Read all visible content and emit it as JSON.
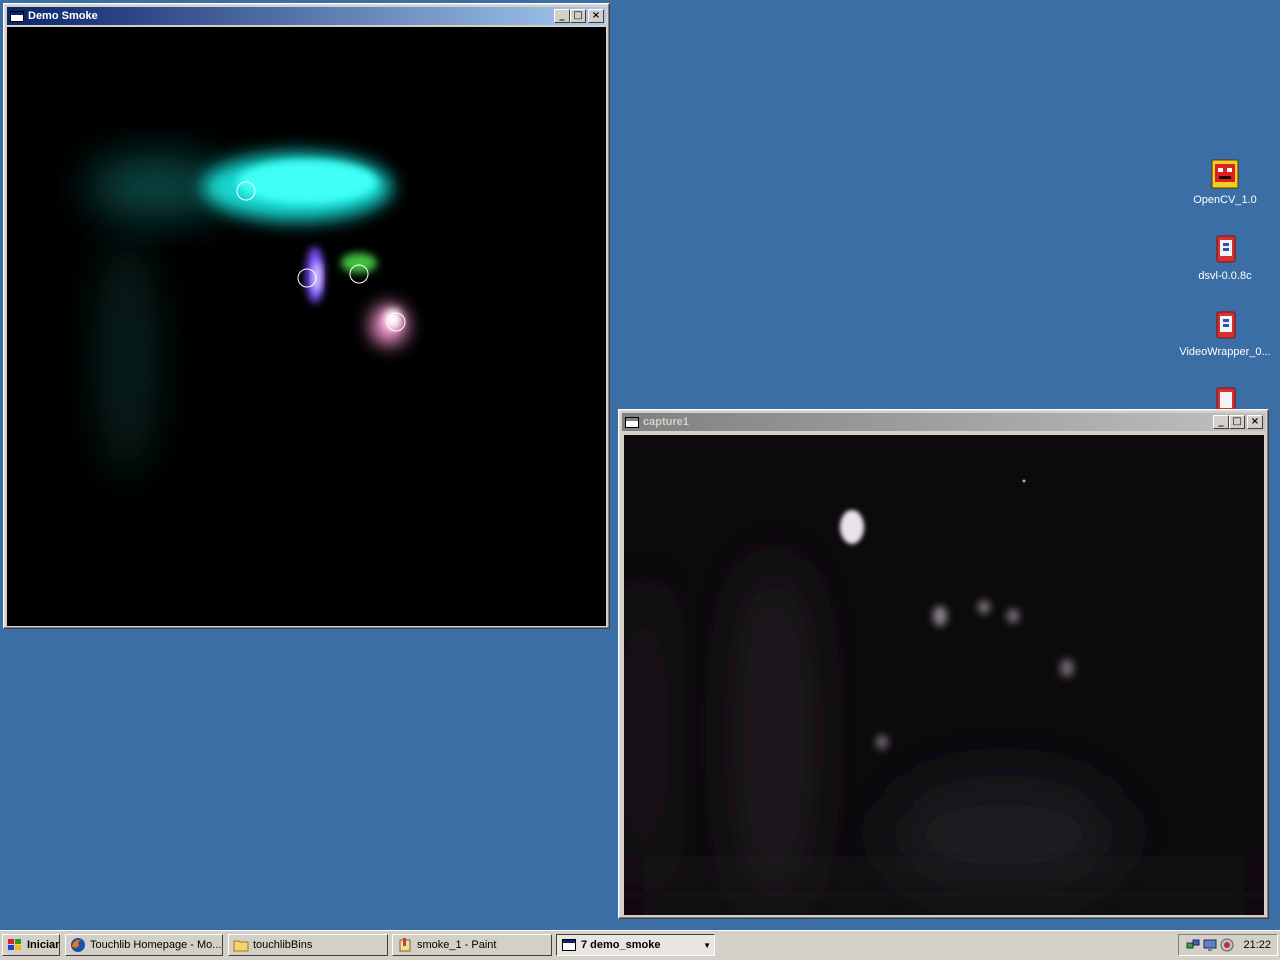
{
  "windows": {
    "demo_smoke": {
      "title": "Demo Smoke"
    },
    "capture": {
      "title": "capture1"
    }
  },
  "title_buttons": {
    "minimize": "_",
    "maximize": "□",
    "close": "×"
  },
  "desktop_icons": [
    {
      "label": "OpenCV_1.0",
      "icon": "opencv-icon"
    },
    {
      "label": "dsvl-0.0.8c",
      "icon": "archive-icon"
    },
    {
      "label": "VideoWrapper_0...",
      "icon": "archive-icon"
    }
  ],
  "taskbar": {
    "start_label": "Iniciar",
    "buttons": [
      {
        "label": "Touchlib Homepage - Mo...",
        "icon": "firefox-icon"
      },
      {
        "label": "touchlibBins",
        "icon": "folder-icon"
      },
      {
        "label": "smoke_1 - Paint",
        "icon": "paint-icon"
      },
      {
        "label": "7 demo_smoke",
        "icon": "window-icon"
      }
    ],
    "clock": "21:22"
  },
  "colors": {
    "desktop": "#3a6ea5",
    "titlebar_active": "#0a246a",
    "smoke_cyan": "#20f0e8",
    "smoke_purple": "#7a50ff",
    "smoke_green": "#40c040",
    "smoke_pink": "#ff9ad8"
  }
}
